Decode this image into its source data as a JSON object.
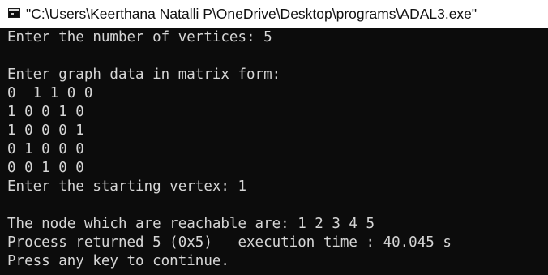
{
  "window": {
    "title": "\"C:\\Users\\Keerthana Natalli P\\OneDrive\\Desktop\\programs\\ADAL3.exe\"",
    "icon": "console-app-icon"
  },
  "console": {
    "lines": [
      "Enter the number of vertices: 5",
      "",
      "Enter graph data in matrix form:",
      "0  1 1 0 0",
      "1 0 0 1 0",
      "1 0 0 0 1",
      "0 1 0 0 0",
      "0 0 1 0 0",
      "Enter the starting vertex: 1",
      "",
      "The node which are reachable are: 1 2 3 4 5",
      "Process returned 5 (0x5)   execution time : 40.045 s",
      "Press any key to continue."
    ]
  },
  "colors": {
    "console_background": "#0c0c0c",
    "console_text": "#d6d6d6",
    "titlebar_background": "#ffffff"
  }
}
